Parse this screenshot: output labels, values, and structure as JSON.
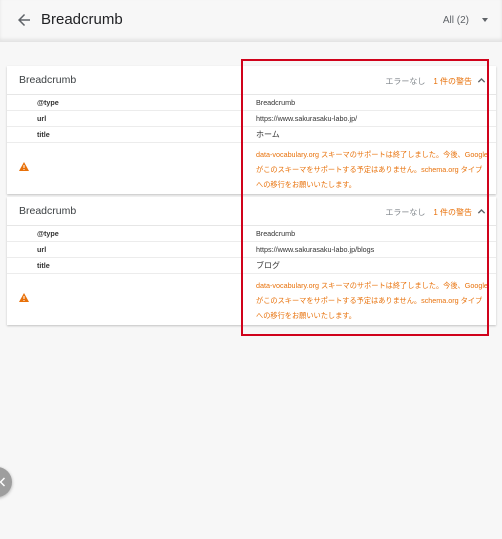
{
  "header": {
    "title": "Breadcrumb",
    "filter_label": "All (2)"
  },
  "cards": [
    {
      "title": "Breadcrumb",
      "status_no_error": "エラーなし",
      "status_warning": "1 件の警告",
      "rows": [
        {
          "key": "@type",
          "value": "Breadcrumb"
        },
        {
          "key": "url",
          "value": "https://www.sakurasaku-labo.jp/"
        },
        {
          "key": "title",
          "value": "ホーム"
        }
      ],
      "warning_message": "data-vocabulary.org スキーマのサポートは終了しました。今後、Google がこのスキーマをサポートする予定はありません。schema.org タイプへの移行をお願いいたします。"
    },
    {
      "title": "Breadcrumb",
      "status_no_error": "エラーなし",
      "status_warning": "1 件の警告",
      "rows": [
        {
          "key": "@type",
          "value": "Breadcrumb"
        },
        {
          "key": "url",
          "value": "https://www.sakurasaku-labo.jp/blogs"
        },
        {
          "key": "title",
          "value": "ブログ"
        }
      ],
      "warning_message": "data-vocabulary.org スキーマのサポートは終了しました。今後、Google がこのスキーマをサポートする予定はありません。schema.org タイプへの移行をお願いいたします。"
    }
  ],
  "colors": {
    "warning": "#e8710a",
    "highlight_box": "#d0021b"
  },
  "icons": {
    "back": "arrow-left-icon",
    "filter": "caret-down-icon",
    "collapse": "chevron-up-icon",
    "warning": "warning-triangle-icon",
    "fab": "chevron-left-icon"
  }
}
